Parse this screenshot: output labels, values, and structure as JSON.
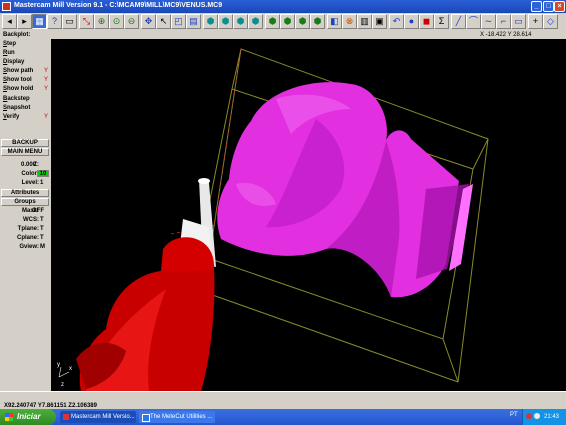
{
  "titlebar": {
    "title": "Mastercam Mill Version 9.1 - C:\\MCAM9\\MILL\\MC9\\VENUS.MC9"
  },
  "status": {
    "label": "Backplot:",
    "coord": "X -18.422  Y 28.614"
  },
  "menu": {
    "items": [
      {
        "first": "S",
        "rest": "tep",
        "flag": ""
      },
      {
        "first": "R",
        "rest": "un",
        "flag": ""
      },
      {
        "first": "D",
        "rest": "isplay",
        "flag": ""
      },
      {
        "first": "S",
        "rest": "how path",
        "flag": "Y"
      },
      {
        "first": "S",
        "rest": "how tool",
        "flag": "Y"
      },
      {
        "first": "S",
        "rest": "how hold",
        "flag": "Y"
      },
      {
        "first": "B",
        "rest": "ackstep",
        "flag": ""
      },
      {
        "first": "S",
        "rest": "napshot",
        "flag": ""
      },
      {
        "first": "V",
        "rest": "erify",
        "flag": "Y"
      }
    ],
    "backup": "BACKUP",
    "main_menu": "MAIN MENU",
    "z_label": "Z:",
    "z_value": "0.000",
    "color_label": "Color:",
    "color_value": "10",
    "level_label": "Level:",
    "level_value": "1",
    "attributes": "Attributes",
    "groups": "Groups",
    "mask_label": "Mask:",
    "mask_value": "OFF",
    "wcs_label": "WCS:",
    "wcs_value": "T",
    "tplane_label": "Tplane:",
    "tplane_value": "T",
    "cplane_label": "Cplane:",
    "cplane_value": "T",
    "gview_label": "Gview:",
    "gview_value": "M"
  },
  "axes": {
    "x": "x",
    "y": "y",
    "z": "z"
  },
  "bottom": {
    "xyz": "X92.240747  Y7.861151  Z2.106389"
  },
  "taskbar": {
    "start": "Iniciar",
    "tasks": [
      "Mastercam Mill Versio...",
      "The MeteCut Utilities ..."
    ],
    "lang": "PT",
    "clock": "21:43"
  },
  "colors": {
    "part": "#e22fe0",
    "spindle": "#d40000",
    "tool": "#f2f2f2",
    "stock_box": "#8a8a2a"
  }
}
